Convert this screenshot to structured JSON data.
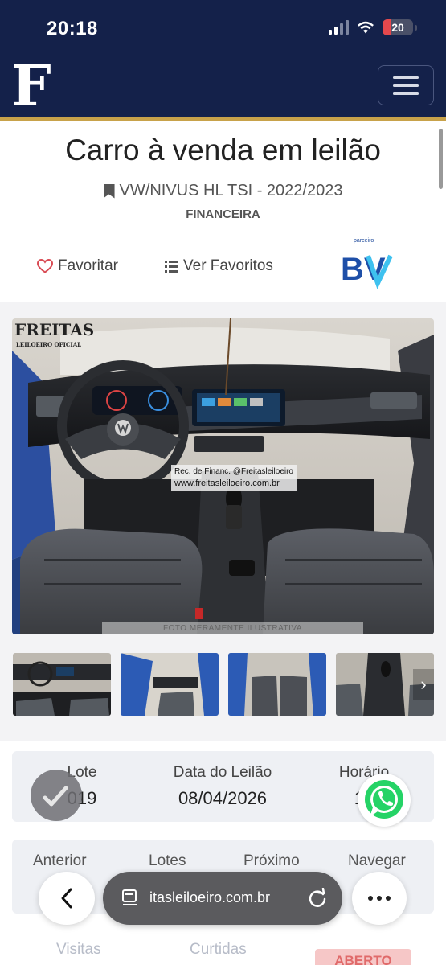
{
  "status_bar": {
    "time": "20:18",
    "battery": "20"
  },
  "header": {
    "logo_letter": "F"
  },
  "listing": {
    "title": "Carro à venda em leilão",
    "vehicle": "VW/NIVUS HL TSI - 2022/2023",
    "category": "FINANCEIRA",
    "favorite_label": "Favoritar",
    "view_favorites_label": "Ver Favoritos",
    "partner_label": "parceiro",
    "partner_logo_text": "BV"
  },
  "photo": {
    "watermark_name": "FREITAS",
    "watermark_sub": "LEILOEIRO OFICIAL",
    "caption_line1": "Rec. de Financ. @Freitasleiloeiro",
    "caption_line2": "www.freitasleiloeiro.com.br",
    "illustrative_note": "FOTO MERAMENTE ILUSTRATIVA"
  },
  "info": {
    "lot_label": "Lote",
    "lot_value": "019",
    "date_label": "Data do Leilão",
    "date_value": "08/04/2026",
    "time_label": "Horário",
    "time_value": "10"
  },
  "navigation": {
    "previous": "Anterior",
    "lots": "Lotes",
    "next": "Próximo",
    "browse": "Navegar"
  },
  "stats": {
    "visits": "Visitas",
    "likes": "Curtidas",
    "status": "ABERTO"
  },
  "browser": {
    "url": "itasleiloeiro.com.br"
  },
  "colors": {
    "header": "#14214a",
    "gold": "#c8a24a",
    "whatsapp": "#25d366"
  }
}
